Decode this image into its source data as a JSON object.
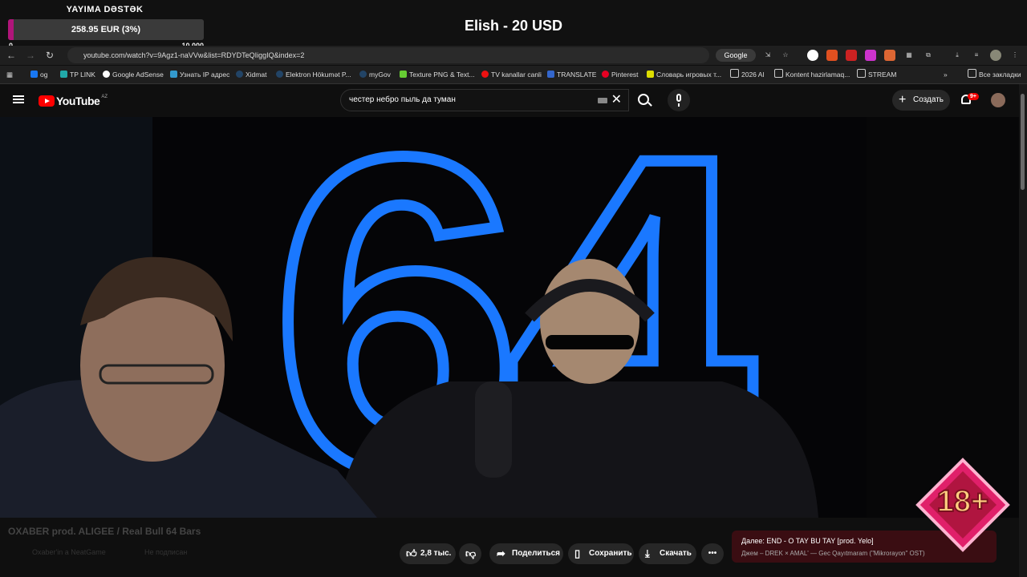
{
  "overlay": {
    "donation_title": "YAYIMA DƏSTƏK",
    "progress_label": "258.95 EUR (3%)",
    "progress_fraction": 0.03,
    "range_min": "0",
    "range_max": "10 000",
    "stream_title": "Elish - 20 USD",
    "age_badge": "18+"
  },
  "browser": {
    "url": "youtube.com/watch?v=9Agz1-naVVw&list=RDYDTeQIiggIQ&index=2",
    "search_engine": "Google",
    "bookmarks": [
      "og",
      "TP LINK",
      "Google AdSense",
      "Узнать IP адрес",
      "Xidmat",
      "Elektron Hökumət P...",
      "myGov",
      "Texture PNG & Text...",
      "TV kanallar canli",
      "TRANSLATE",
      "Pinterest",
      "Словарь игровых т...",
      "2026 Al",
      "Kontent hazirlamaq...",
      "STREAM"
    ],
    "all_bookmarks": "Все закладки"
  },
  "youtube": {
    "logo_text": "YouTube",
    "region": "AZ",
    "search_query": "честер небро пыль да туман",
    "create_label": "Создать",
    "notif_badge": "9+",
    "video_overlay": "64",
    "ghost_title": "OXABER prod. ALIGEE / Real Bull 64 Bars",
    "ghost_sub": "Oxaber'in a NeatGame",
    "ghost_sub2": "Не подписан",
    "like_count": "2,8 тыс.",
    "share_label": "Поделиться",
    "save_label": "Сохранить",
    "download_label": "Скачать",
    "next_title": "Далее: END - O TAY BU TAY [prod. Yelo]",
    "next_sub": "Джем – DREK × AMAL' — Gec Qayıtmaram (\"Mikrorayon\" OST)"
  },
  "colors": {
    "accent": "#b0157a",
    "yt_red": "#ff0000",
    "neon": "#1a78ff"
  }
}
